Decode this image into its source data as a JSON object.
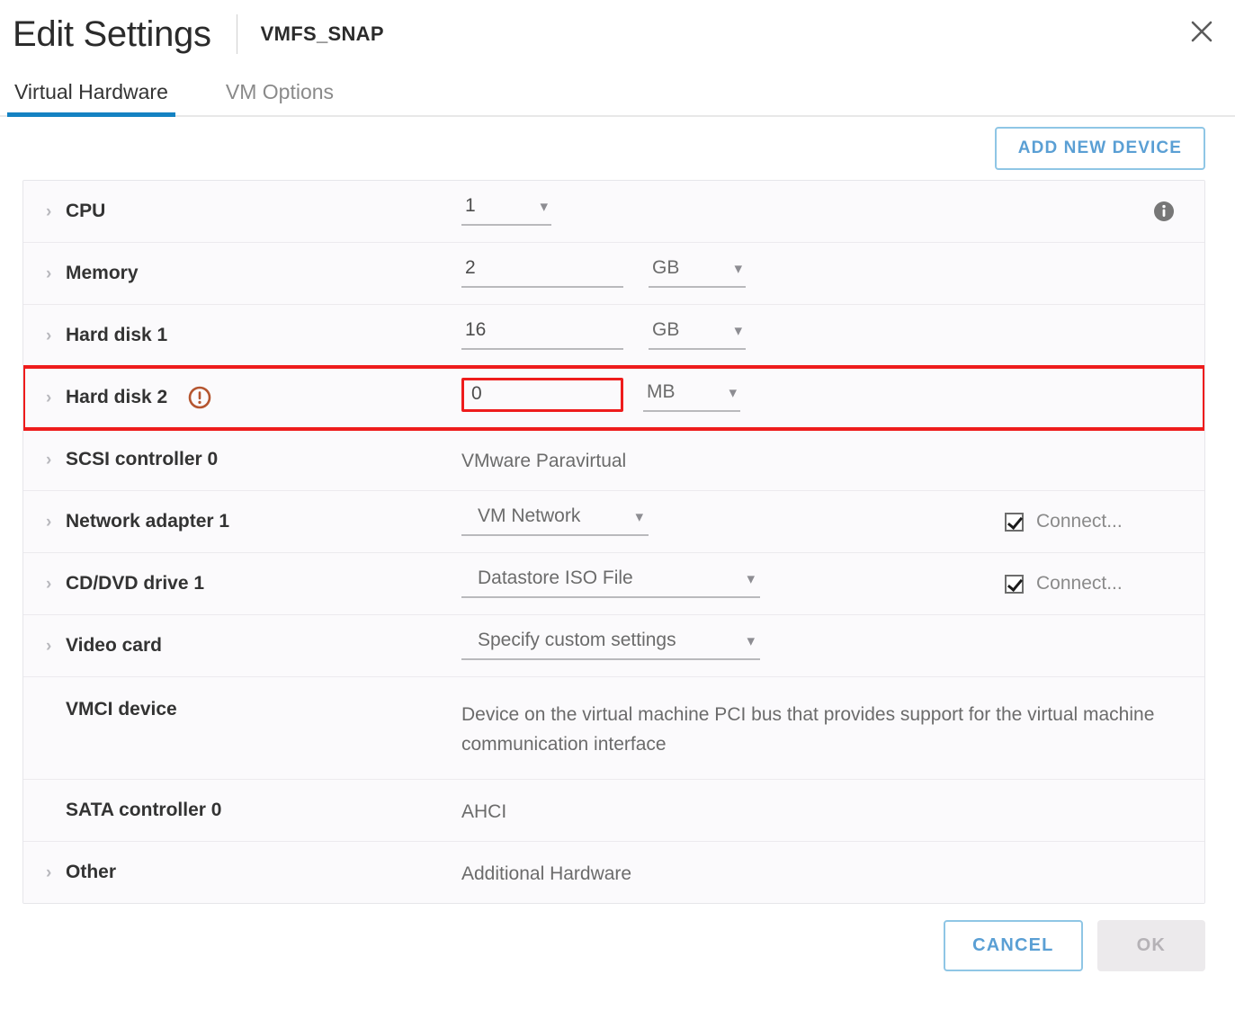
{
  "header": {
    "title": "Edit Settings",
    "subtitle": "VMFS_SNAP",
    "close_icon": "close-icon"
  },
  "tabs": [
    {
      "label": "Virtual Hardware",
      "active": true
    },
    {
      "label": "VM Options",
      "active": false
    }
  ],
  "toolbar": {
    "add_device_label": "ADD NEW DEVICE"
  },
  "colors": {
    "accent_blue": "#1482c2",
    "link_blue": "#5a9fd4",
    "alert_red": "#ee1c1c",
    "warning_icon": "#b5552f",
    "row_bg": "#fbfafc"
  },
  "devices": [
    {
      "name": "CPU",
      "value": "1",
      "info_icon": "info-icon"
    },
    {
      "name": "Memory",
      "value": "2",
      "unit": "GB"
    },
    {
      "name": "Hard disk 1",
      "value": "16",
      "unit": "GB"
    },
    {
      "name": "Hard disk 2",
      "value": "0",
      "unit": "MB",
      "warning_icon": "warning-exclamation-icon"
    },
    {
      "name": "SCSI controller 0",
      "text": "VMware Paravirtual"
    },
    {
      "name": "Network adapter 1",
      "select": "VM Network",
      "connect_label": "Connect...",
      "connect_checked": true
    },
    {
      "name": "CD/DVD drive 1",
      "select": "Datastore ISO File",
      "connect_label": "Connect...",
      "connect_checked": true
    },
    {
      "name": "Video card",
      "select": "Specify custom settings"
    },
    {
      "name": "VMCI device",
      "text": "Device on the virtual machine PCI bus that provides support for the virtual machine communication interface"
    },
    {
      "name": "SATA controller 0",
      "text": "AHCI"
    },
    {
      "name": "Other",
      "text": "Additional Hardware"
    }
  ],
  "footer": {
    "cancel_label": "CANCEL",
    "ok_label": "OK"
  }
}
